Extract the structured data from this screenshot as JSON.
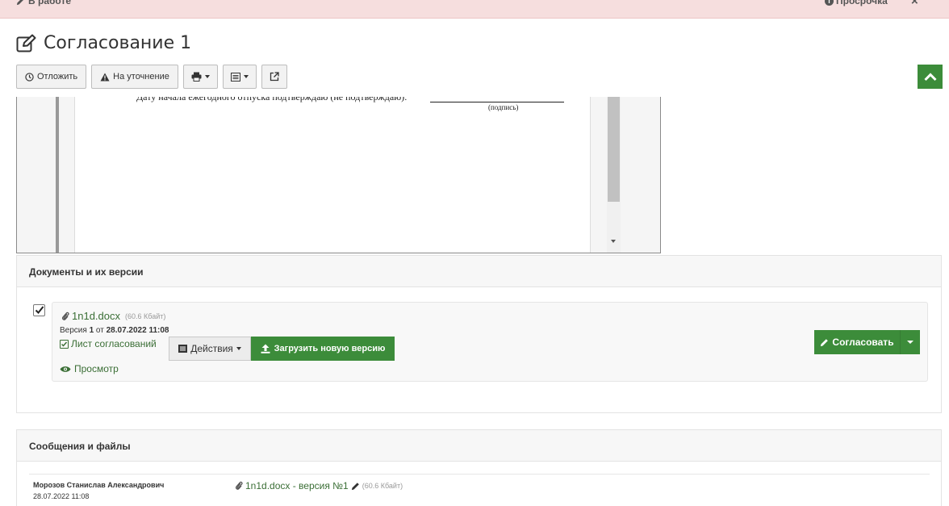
{
  "topbar": {
    "status_label": "В работе",
    "overdue_label": "Просрочка",
    "close_glyph": "×"
  },
  "title": {
    "text": "Согласование 1",
    "icon": "edit-icon"
  },
  "toolbar": {
    "postpone_label": "Отложить",
    "clarify_label": "На уточнение",
    "print_icon": "print-icon",
    "list_icon": "list-icon",
    "external_icon": "external-link-icon"
  },
  "preview": {
    "text_line": "Дату начала ежегодного отпуска подтверждаю (не подтверждаю):",
    "signature_caption": "(подпись)"
  },
  "documents_panel": {
    "header": "Документы и их версии",
    "file_name": "1n1d.docx",
    "file_size": "(60.6 Кбайт)",
    "version_prefix": "Версия",
    "version_number": "1",
    "version_from": "от",
    "version_date": "28.07.2022 11:08",
    "sheet_label": "Лист согласований",
    "actions_label": "Действия",
    "upload_label": "Загрузить новую версию",
    "view_label": "Просмотр",
    "approve_label": "Согласовать",
    "checked": true
  },
  "messages_panel": {
    "header": "Сообщения и файлы",
    "author": "Морозов Станислав Александрович",
    "date": "28.07.2022 11:08",
    "file_label": "1n1d.docx - версия №1",
    "file_size": "(60.6 Кбайт)"
  },
  "colors": {
    "topbar_bg": "#f6dede",
    "brand_green": "#3c8c3a",
    "link_green": "#3a6e35"
  }
}
